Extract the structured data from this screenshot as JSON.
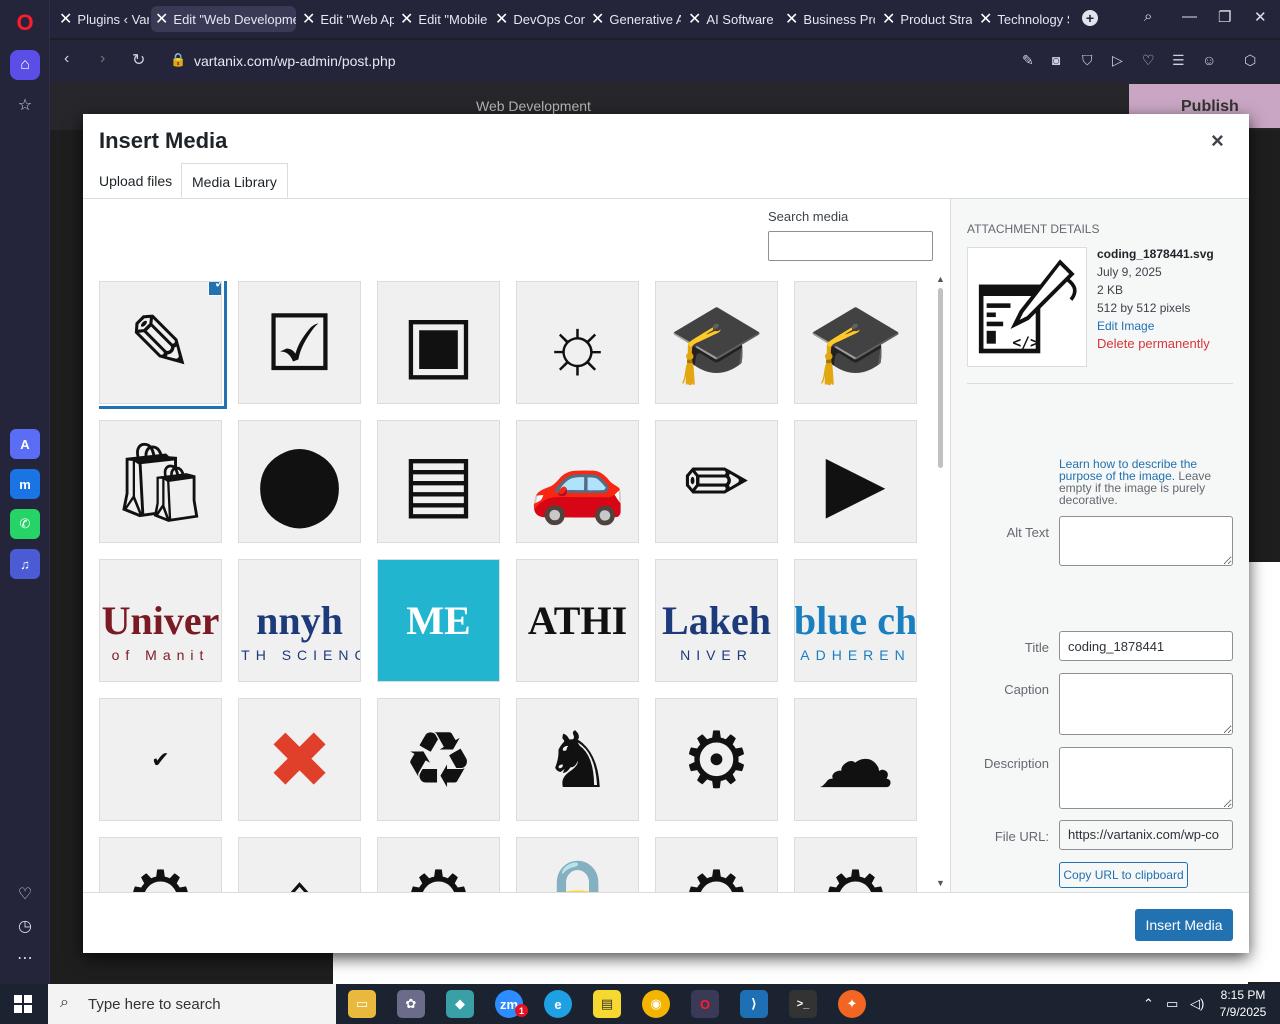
{
  "browser": {
    "tabs": [
      {
        "label": "Plugins ‹ Vart",
        "active": false
      },
      {
        "label": "Edit \"Web Developme",
        "active": true
      },
      {
        "label": "Edit \"Web Ap",
        "active": false
      },
      {
        "label": "Edit \"Mobile",
        "active": false
      },
      {
        "label": "DevOps Con",
        "active": false
      },
      {
        "label": "Generative A",
        "active": false
      },
      {
        "label": "AI Software I",
        "active": false
      },
      {
        "label": "Business Pro",
        "active": false
      },
      {
        "label": "Product Strat",
        "active": false
      },
      {
        "label": "Technology S",
        "active": false
      }
    ],
    "url": "vartanix.com/wp-admin/post.php"
  },
  "editor": {
    "page_label": "Web Development",
    "publish_label": "Publish"
  },
  "modal": {
    "title": "Insert Media",
    "close": "×",
    "tabs": {
      "upload": "Upload files",
      "library": "Media Library"
    },
    "search_label": "Search media",
    "search_value": "",
    "thumbs": [
      {
        "kind": "icon",
        "icon": "coding-icon",
        "glyph": "✎",
        "selected": true
      },
      {
        "kind": "icon",
        "icon": "mobile-check-icon",
        "glyph": "☑"
      },
      {
        "kind": "icon",
        "icon": "online-certificate-icon",
        "glyph": "▣"
      },
      {
        "kind": "icon",
        "icon": "idea-screen-icon",
        "glyph": "☼"
      },
      {
        "kind": "icon",
        "icon": "graduation-cap-icon",
        "glyph": "🎓"
      },
      {
        "kind": "icon",
        "icon": "graduation-cap-icon",
        "glyph": "🎓"
      },
      {
        "kind": "icon",
        "icon": "shopping-bag-icon",
        "glyph": "🛍"
      },
      {
        "kind": "icon",
        "icon": "tooth-icon",
        "glyph": "⬤"
      },
      {
        "kind": "icon",
        "icon": "storefront-icon",
        "glyph": "▤"
      },
      {
        "kind": "icon",
        "icon": "car-service-icon",
        "glyph": "🚗"
      },
      {
        "kind": "icon",
        "icon": "pencil-brush-icon",
        "glyph": "✏"
      },
      {
        "kind": "icon",
        "icon": "video-marketing-icon",
        "glyph": "▶"
      },
      {
        "kind": "text",
        "text": "Univer",
        "sub": "of Manit",
        "color": "#7a1a22",
        "bg": "#f0f0f1"
      },
      {
        "kind": "text",
        "text": "nnyh",
        "sub": "LTH SCIENC",
        "color": "#1d3a7a",
        "bg": "#f0f0f1"
      },
      {
        "kind": "text",
        "text": "ME",
        "sub": "",
        "color": "#ffffff",
        "bg": "#22b5cf"
      },
      {
        "kind": "text",
        "text": "ATHI",
        "sub": "",
        "color": "#111111",
        "bg": "#f0f0f1"
      },
      {
        "kind": "text",
        "text": "Lakeh",
        "sub": "NIVER",
        "color": "#1d3a7a",
        "bg": "#f0f0f1"
      },
      {
        "kind": "text",
        "text": "blue ch",
        "sub": "ADHEREN",
        "color": "#1a7fc0",
        "bg": "#f0f0f1"
      },
      {
        "kind": "icon",
        "icon": "check-circle-icon",
        "glyph": "✔"
      },
      {
        "kind": "icon",
        "icon": "error-x-icon",
        "glyph": "✖"
      },
      {
        "kind": "icon",
        "icon": "puzzle-cycle-icon",
        "glyph": "♻"
      },
      {
        "kind": "icon",
        "icon": "strategy-chess-icon",
        "glyph": "♞"
      },
      {
        "kind": "icon",
        "icon": "repair-computer-icon",
        "glyph": "⚙"
      },
      {
        "kind": "icon",
        "icon": "cloud-upload-icon",
        "glyph": "☁"
      },
      {
        "kind": "icon",
        "icon": "dashboard-gear-icon",
        "glyph": "⚙"
      },
      {
        "kind": "icon",
        "icon": "real-estate-screen-icon",
        "glyph": "⌂"
      },
      {
        "kind": "icon",
        "icon": "gear-icon",
        "glyph": "⚙"
      },
      {
        "kind": "icon",
        "icon": "secure-document-icon",
        "glyph": "🔒"
      },
      {
        "kind": "icon",
        "icon": "gear-outline-icon",
        "glyph": "⚙"
      },
      {
        "kind": "icon",
        "icon": "document-gear-icon",
        "glyph": "⚙"
      }
    ],
    "details": {
      "heading": "ATTACHMENT DETAILS",
      "filename": "coding_1878441.svg",
      "date": "July 9, 2025",
      "size": "2 KB",
      "dimensions": "512 by 512 pixels",
      "edit_link": "Edit Image",
      "delete_link": "Delete permanently",
      "alt_label": "Alt Text",
      "alt_value": "",
      "alt_help_link": "Learn how to describe the purpose of the image.",
      "alt_help_text": " Leave empty if the image is purely decorative.",
      "title_label": "Title",
      "title_value": "coding_1878441",
      "caption_label": "Caption",
      "caption_value": "",
      "description_label": "Description",
      "description_value": "",
      "fileurl_label": "File URL:",
      "fileurl_value": "https://vartanix.com/wp-co",
      "copy_label": "Copy URL to clipboard"
    },
    "insert_label": "Insert Media"
  },
  "taskbar": {
    "search_placeholder": "Type here to search",
    "time": "8:15 PM",
    "date": "7/9/2025",
    "zoom_badge": "1"
  },
  "colors": {
    "accent": "#2271b1",
    "delete": "#d63638",
    "opera_red": "#ff1b2d"
  }
}
